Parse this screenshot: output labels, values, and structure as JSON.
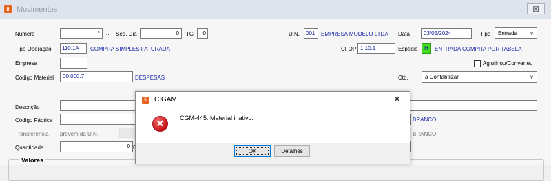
{
  "window": {
    "title": "Movimentos",
    "close_glyph": "⊠",
    "icon": "cigam-logo-icon"
  },
  "form": {
    "numero": {
      "label": "Número",
      "value": "*",
      "lookup": "..."
    },
    "seq_dia": {
      "label": "Seq. Dia",
      "value": "0"
    },
    "tg": {
      "label": "TG",
      "value": "0"
    },
    "un": {
      "label": "U.N.",
      "code": "001",
      "name": "EMPRESA MODELO LTDA"
    },
    "data": {
      "label": "Data",
      "value": "03/05/2024"
    },
    "tipo": {
      "label": "Tipo",
      "selected": "Entrada"
    },
    "tipo_operacao": {
      "label": "Tipo Operação",
      "code": "110.1A",
      "name": "COMPRA SIMPLES FATURADA"
    },
    "cfop": {
      "label": "CFOP",
      "value": "1.10.1"
    },
    "especie": {
      "label": "Espécie",
      "code": "H",
      "name": "ENTRADA COMPRA POR TABELA"
    },
    "empresa": {
      "label": "Empresa",
      "value": ""
    },
    "aglutinou": {
      "label": "Aglutinou/Converteu",
      "checked": false
    },
    "codigo_material": {
      "label": "Código Material",
      "value": "00.000.7",
      "name": "DESPESAS"
    },
    "ctb": {
      "label": "Ctb.",
      "selected": "a Contabilizar"
    },
    "descricao": {
      "label": "Descrição",
      "value": ""
    },
    "codigo_fabrica": {
      "label": "Código Fábrica",
      "value": "",
      "name": "BRANCO"
    },
    "transferencia": {
      "label": "Transferência",
      "value": "provêm da U.N.",
      "name": "BRANCO"
    },
    "quantidade": {
      "label": "Quantidade",
      "value": "0",
      "suffix": "B"
    },
    "valores": {
      "label": "Valores"
    }
  },
  "dialog": {
    "title": "CIGAM",
    "close_glyph": "✕",
    "icon": "error-icon",
    "message": "CGM-445: Material inativo.",
    "ok_label": "OK",
    "details_label": "Detalhes"
  },
  "colors": {
    "accent_blue": "#1a2aa8",
    "especie_green": "#44dd22",
    "error_red": "#c8121a",
    "logo_orange": "#e8641e"
  }
}
